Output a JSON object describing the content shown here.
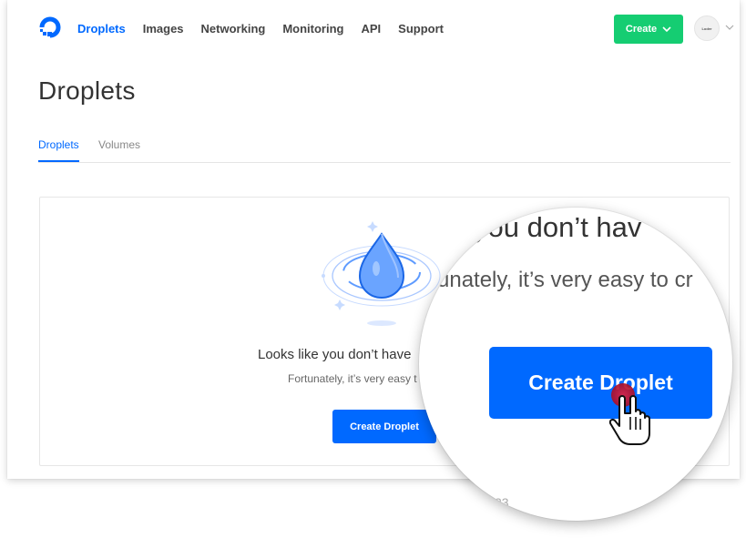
{
  "nav": {
    "links": [
      "Droplets",
      "Images",
      "Networking",
      "Monitoring",
      "API",
      "Support"
    ],
    "create_label": "Create",
    "avatar_text": "Loder"
  },
  "page": {
    "title": "Droplets",
    "tabs": [
      "Droplets",
      "Volumes"
    ]
  },
  "empty_state": {
    "heading": "Looks like you don’t have",
    "subtext": "Fortunately, it’s very easy t",
    "button_label": "Create Droplet"
  },
  "magnifier": {
    "heading": "you don’t hav",
    "subtext": "unately, it’s very easy to cr",
    "button_label": "Create Droplet",
    "footer_text": "23"
  },
  "colors": {
    "brand_blue": "#0069ff",
    "create_green": "#15cd72",
    "cursor_dot": "#c4122f"
  }
}
